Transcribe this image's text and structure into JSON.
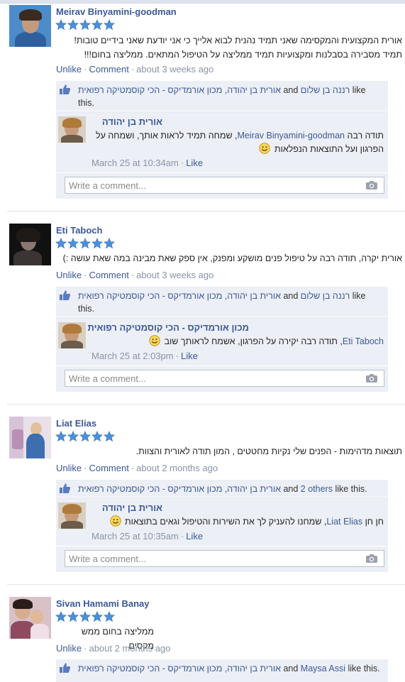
{
  "reviews": [
    {
      "author": "Meirav Binyamini-goodman",
      "rating": 5,
      "text": "אורית המקצועית והמקסימה שאני תמיד נהנית לבוא אלייך כי אני יודעת שאני בידיים טובות! תמיד מסבירה בסבלנות ומקצועיות תמיד ממליצה על הטיפול המתאים. ממליצה בחום!!!",
      "actions": {
        "unlike": "Unlike",
        "comment": "Comment",
        "time": "about 3 weeks ago"
      },
      "likes": {
        "names_a": "רננה בן שלום",
        "and": "and",
        "names_b": "אורית בן יהודה, מכון אורמדיקס - הכי קוסמטיקה רפואית",
        "suffix": "like this."
      },
      "reply": {
        "name": "אורית בן יהודה",
        "mention": "Meirav Binyamini-goodman",
        "text_before": "תודה רבה",
        "text_after": ", שמחה תמיד לראות אותך, ושמחה על הפרגון ועל התוצאות הנפלאות",
        "time": "March 25 at 10:34am",
        "like": "Like"
      },
      "comment_placeholder": "Write a comment..."
    },
    {
      "author": "Eti Taboch",
      "rating": 5,
      "text": "אורית יקרה, תודה רבה על טיפול פנים מושקע ומפנק, אין ספק שאת מבינה במה שאת עושה :)",
      "actions": {
        "unlike": "Unlike",
        "comment": "Comment",
        "time": "about 3 weeks ago"
      },
      "likes": {
        "names_a": "רננה בן שלום",
        "and": "and",
        "names_b": "אורית בן יהודה, מכון אורמדיקס - הכי קוסמטיקה רפואית",
        "suffix": "like this."
      },
      "reply": {
        "name": "מכון אורמדיקס - הכי קוסמטיקה רפואית",
        "mention": "Eti Taboch",
        "text_before": "",
        "text_after": ", תודה רבה יקירה על הפרגון, אשמח לראותך שוב",
        "time": "March 25 at 2:03pm",
        "like": "Like"
      },
      "comment_placeholder": "Write a comment..."
    },
    {
      "author": "Liat Elias",
      "rating": 5,
      "text": "תוצאות מדהימות - הפנים שלי נקיות מחטטים , המון תודה לאורית והצוות.",
      "actions": {
        "unlike": "Unlike",
        "comment": "Comment",
        "time": "about 2 months ago"
      },
      "likes": {
        "names_a": "אורית בן יהודה, מכון אורמדיקס - הכי קוסמטיקה רפואית",
        "and": "and",
        "names_b": "2 others",
        "suffix": "like this."
      },
      "reply": {
        "name": "אורית בן יהודה",
        "mention": "Liat Elias",
        "text_before": "חן חן",
        "text_after": ", שמחנו להעניק לך את השירות והטיפול וגאים בתוצאות",
        "time": "March 25 at 10:35am",
        "like": "Like"
      },
      "comment_placeholder": "Write a comment..."
    },
    {
      "author": "Sivan Hamami Banay",
      "rating": 5,
      "text": "ממליצה בחום ממש מקסים",
      "actions": {
        "unlike": "Unlike",
        "time": "about 2 months ago"
      },
      "likes": {
        "names_a": "Maysa Assi",
        "and": "and",
        "names_b": "אורית בן יהודה, מכון אורמדיקס - הכי קוסמטיקה רפואית",
        "suffix": "like this."
      }
    }
  ],
  "colors": {
    "link": "#3b5998",
    "star": "#4a8fd8",
    "box": "#eceff5",
    "meta": "#8a93a8"
  },
  "icons": {
    "star": "star-icon",
    "like": "thumbs-up-icon",
    "camera": "camera-icon",
    "smiley": "smiley-icon"
  }
}
